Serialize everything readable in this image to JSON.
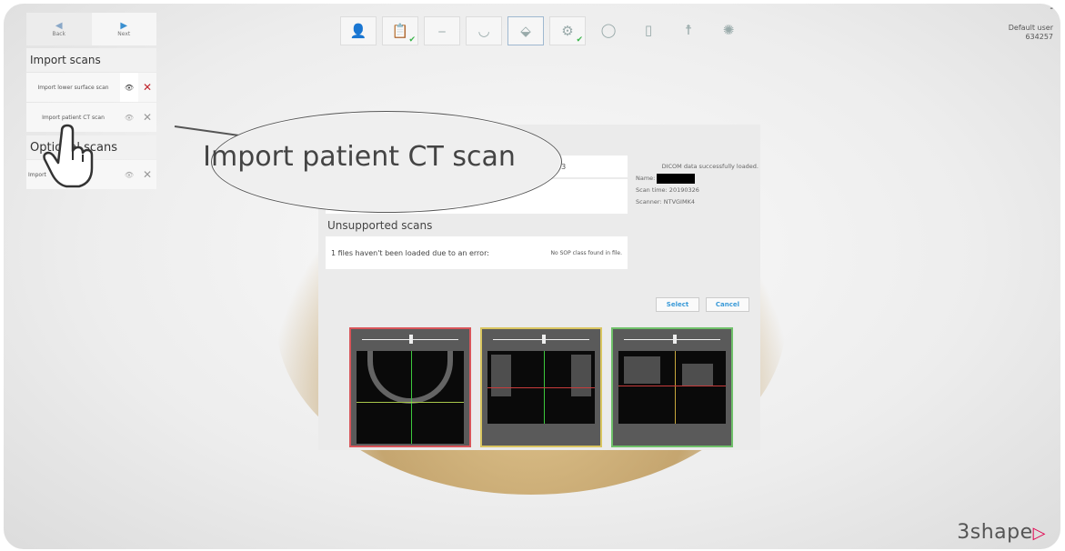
{
  "nav": {
    "back_label": "Back",
    "next_label": "Next"
  },
  "user": {
    "name": "Default user",
    "id": "634257"
  },
  "workflow_icons": [
    "patient-icon",
    "order-form-icon",
    "scanner-icon",
    "tooth-scan-icon",
    "ct-import-icon",
    "planning-icon",
    "crown-icon",
    "implant-icon",
    "surgeon-icon",
    "guide-icon"
  ],
  "sidebar": {
    "import_title": "Import scans",
    "scan_items": [
      {
        "label": "Import lower surface scan"
      },
      {
        "label": "Import patient CT scan"
      }
    ],
    "optional_title": "Optional scans",
    "optional_items": [
      {
        "label": "Import"
      }
    ]
  },
  "dialog": {
    "file_info": "10x273",
    "status": "DICOM data successfully loaded.",
    "name_label": "Name:",
    "scan_time": "Scan time:  20190326",
    "scanner": "Scanner:  NTVGIMK4",
    "unsupported_title": "Unsupported scans",
    "unsupported_message": "1 files haven't been loaded due to an error:",
    "unsupported_error": "No SOP class found in file.",
    "select_label": "Select",
    "cancel_label": "Cancel"
  },
  "callout": {
    "text": "Import patient CT scan"
  },
  "brand": {
    "logo_text": "3shape",
    "logo_color": "#e1004e"
  },
  "colors": {
    "panel_red": "#d8555a",
    "panel_yellow": "#d9c560",
    "panel_green": "#6fc06a",
    "accent_blue": "#3a9ad8"
  }
}
